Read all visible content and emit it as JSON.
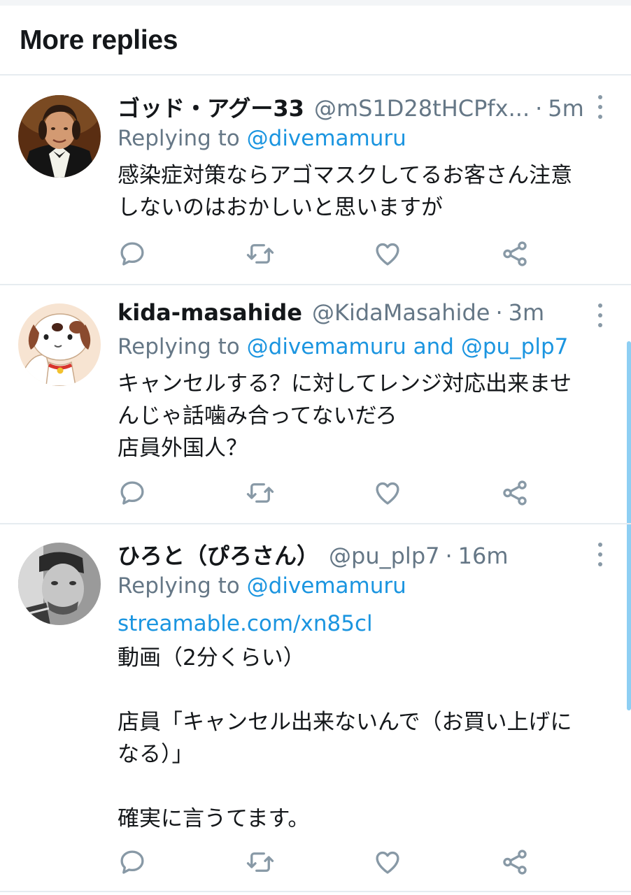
{
  "section": {
    "title": "More replies"
  },
  "reply_prefix": "Replying to",
  "reply_and": "and",
  "colors": {
    "accent": "#1b95e0",
    "secondary_text": "#657786",
    "icon": "#8899a6",
    "divider": "#e6ecf0",
    "scrollbar": "#8ecff3"
  },
  "icons": [
    "reply-icon",
    "retweet-icon",
    "like-icon",
    "share-icon",
    "more-options-icon"
  ],
  "tweets": [
    {
      "name": "ゴッド・アグー33",
      "handle": "@mS1D28tHCPfx...",
      "time": "5m",
      "replying_to": [
        "@divemamuru"
      ],
      "lines": [
        "感染症対策ならアゴマスクしてるお客さん注意",
        "しないのはおかしいと思いますが"
      ]
    },
    {
      "name": "kida-masahide",
      "handle": "@KidaMasahide",
      "time": "3m",
      "replying_to": [
        "@divemamuru",
        "@pu_plp7"
      ],
      "lines": [
        "キャンセルする？に対してレンジ対応出来ませ",
        "んじゃ話噛み合ってないだろ",
        "店員外国人？"
      ]
    },
    {
      "name": "ひろと（ぴろさん）",
      "handle": "@pu_plp7",
      "time": "16m",
      "replying_to": [
        "@divemamuru"
      ],
      "link": "streamable.com/xn85cl",
      "lines": [
        "動画（2分くらい）",
        "",
        "店員「キャンセル出来ないんで（お買い上げに",
        "なる）」",
        "",
        "確実に言うてます。"
      ]
    }
  ]
}
